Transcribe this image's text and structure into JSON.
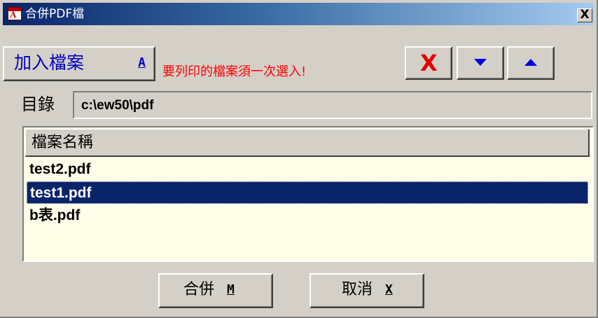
{
  "window": {
    "title": "合併PDF檔",
    "close_label": "X",
    "icon_name": "pdf-app-icon",
    "icon_glyph": "A"
  },
  "toolbar": {
    "add_label": "加入檔案",
    "add_shortcut": "A",
    "warning": "要列印的檔案須一次選入!",
    "delete_icon": "delete-x-icon",
    "delete_glyph": "X",
    "move_down_icon": "arrow-down-icon",
    "move_up_icon": "arrow-up-icon"
  },
  "directory": {
    "label": "目錄",
    "value": "c:\\ew50\\pdf"
  },
  "file_list": {
    "header": "檔案名稱",
    "items": [
      {
        "name": "test2.pdf",
        "selected": false
      },
      {
        "name": "test1.pdf",
        "selected": true
      },
      {
        "name": "b表.pdf",
        "selected": false
      }
    ]
  },
  "buttons": {
    "merge_label": "合併",
    "merge_shortcut": "M",
    "cancel_label": "取消",
    "cancel_shortcut": "X"
  },
  "colors": {
    "title_gradient_start": "#0a246a",
    "selection": "#0a246a",
    "warning": "#ff0000",
    "accent_blue": "#0000c0"
  }
}
